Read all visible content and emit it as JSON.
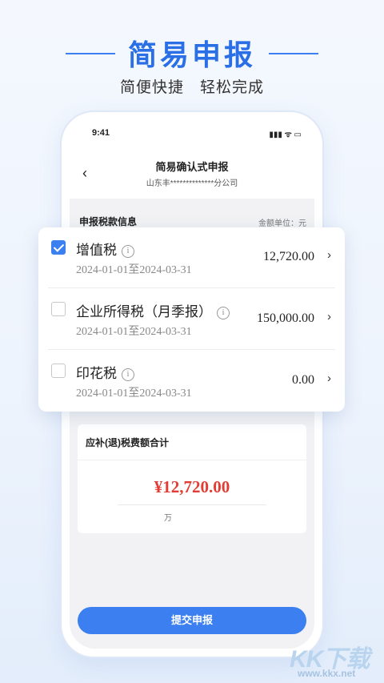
{
  "hero": {
    "title": "简易申报",
    "subtitle": "简便快捷　轻松完成"
  },
  "status_bar": {
    "time": "9:41",
    "icons": "▮▮▮ ᯤ ▭"
  },
  "header": {
    "title": "简易确认式申报",
    "subtitle": "山东丰**************分公司"
  },
  "section": {
    "title": "申报税款信息",
    "unit_note": "金额单位：元"
  },
  "tax_items": [
    {
      "name": "增值税",
      "period": "2024-01-01至2024-03-31",
      "amount": "12,720.00",
      "checked": true
    },
    {
      "name": "企业所得税（月季报）",
      "period": "2024-01-01至2024-03-31",
      "amount": "150,000.00",
      "checked": false
    },
    {
      "name": "印花税",
      "period": "2024-01-01至2024-03-31",
      "amount": "0.00",
      "checked": false
    }
  ],
  "total": {
    "label": "应补(退)税费额合计",
    "amount": "¥12,720.00",
    "unit": "万"
  },
  "submit_label": "提交申报",
  "watermark": {
    "text": "KK下载",
    "url": "www.kkx.net"
  },
  "colors": {
    "accent": "#3b7ff0",
    "amount_red": "#e23c34"
  }
}
